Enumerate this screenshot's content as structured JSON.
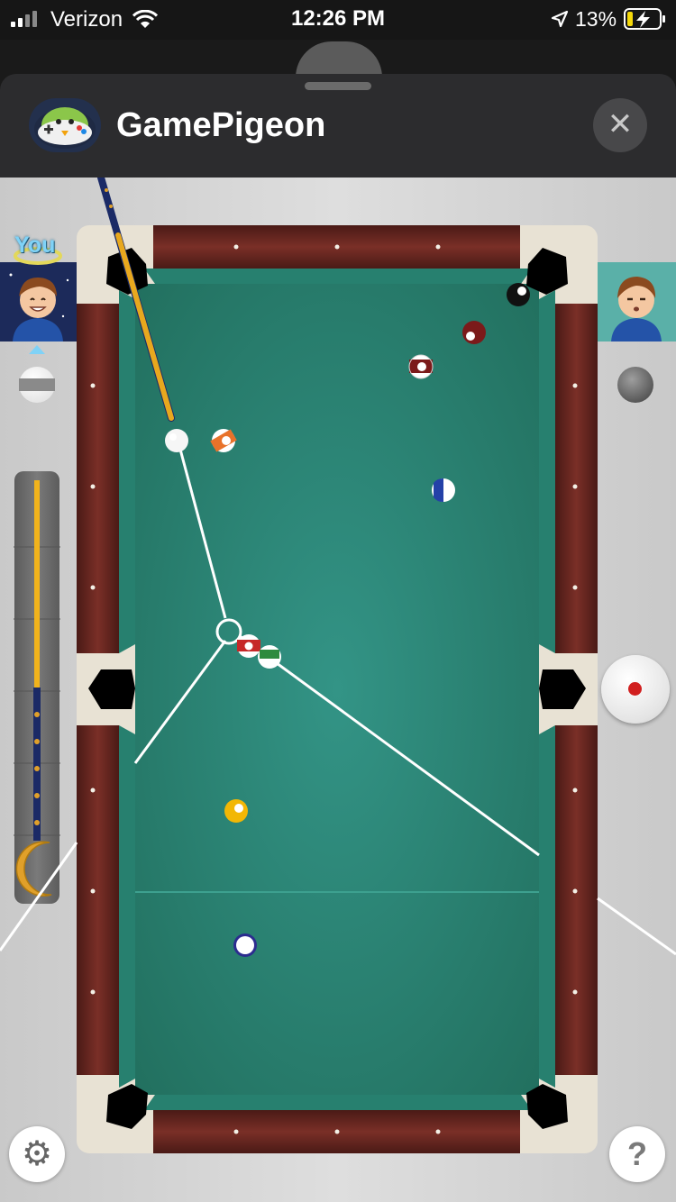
{
  "status_bar": {
    "carrier": "Verizon",
    "time": "12:26 PM",
    "battery_percent": "13%",
    "icons": [
      "signal-icon",
      "wifi-icon",
      "location-arrow-icon",
      "battery-charging-icon"
    ]
  },
  "sheet": {
    "title": "GamePigeon",
    "close_glyph": "✕"
  },
  "players": {
    "you_label": "You",
    "you_group": "stripes",
    "opponent_group": "solids"
  },
  "table": {
    "felt_color": "#2f8a7c",
    "rail_color": "#6a2a22",
    "corner_color": "#e8e2d4",
    "aim_line_color": "#ffffff"
  },
  "balls": [
    {
      "id": "8",
      "color": "#111111",
      "stripe": false
    },
    {
      "id": "7",
      "color": "#7b1a1a",
      "stripe": false
    },
    {
      "id": "15",
      "color": "#7b1a1a",
      "stripe": true
    },
    {
      "id": "13",
      "color": "#e8722a",
      "stripe": true
    },
    {
      "id": "10",
      "color": "#2441a8",
      "stripe": true
    },
    {
      "id": "11",
      "color": "#c62828",
      "stripe": true
    },
    {
      "id": "14",
      "color": "#2e8b3e",
      "stripe": true
    },
    {
      "id": "1",
      "color": "#f2b705",
      "stripe": false
    },
    {
      "id": "2",
      "color": "#2c2c8f",
      "stripe": false
    },
    {
      "id": "cue",
      "color": "#ffffff",
      "stripe": false
    }
  ],
  "controls": {
    "settings_glyph": "⚙",
    "help_glyph": "?",
    "spin_control": "cue-spin-selector"
  }
}
